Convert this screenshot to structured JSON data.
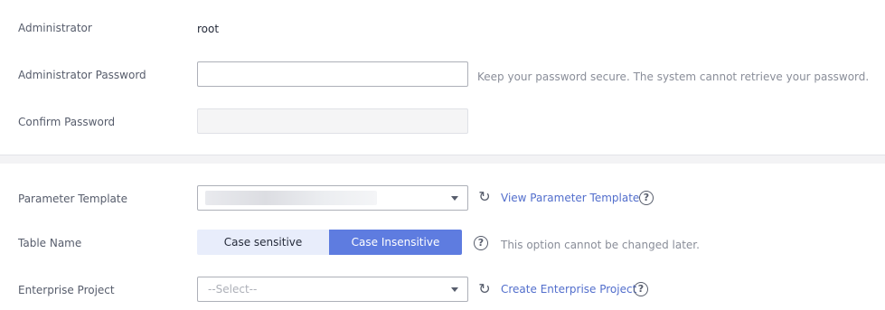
{
  "admin": {
    "label": "Administrator",
    "value": "root"
  },
  "password": {
    "label": "Administrator Password",
    "value": "",
    "hint": "Keep your password secure. The system cannot retrieve your password."
  },
  "confirm": {
    "label": "Confirm Password",
    "value": ""
  },
  "param_template": {
    "label": "Parameter Template",
    "link": "View Parameter Template",
    "refresh_icon": "refresh-icon",
    "help_icon": "question-circle-icon"
  },
  "table_name": {
    "label": "Table Name",
    "options": [
      "Case sensitive",
      "Case Insensitive"
    ],
    "selected": "Case Insensitive",
    "hint": "This option cannot be changed later.",
    "help_icon": "question-circle-icon"
  },
  "enterprise": {
    "label": "Enterprise Project",
    "placeholder": "--Select--",
    "link": "Create Enterprise Project",
    "refresh_icon": "refresh-icon",
    "help_icon": "question-circle-icon"
  },
  "colors": {
    "accent": "#5e7ce0",
    "link": "#526ecc",
    "toggle_off_bg": "#e8edfb"
  }
}
